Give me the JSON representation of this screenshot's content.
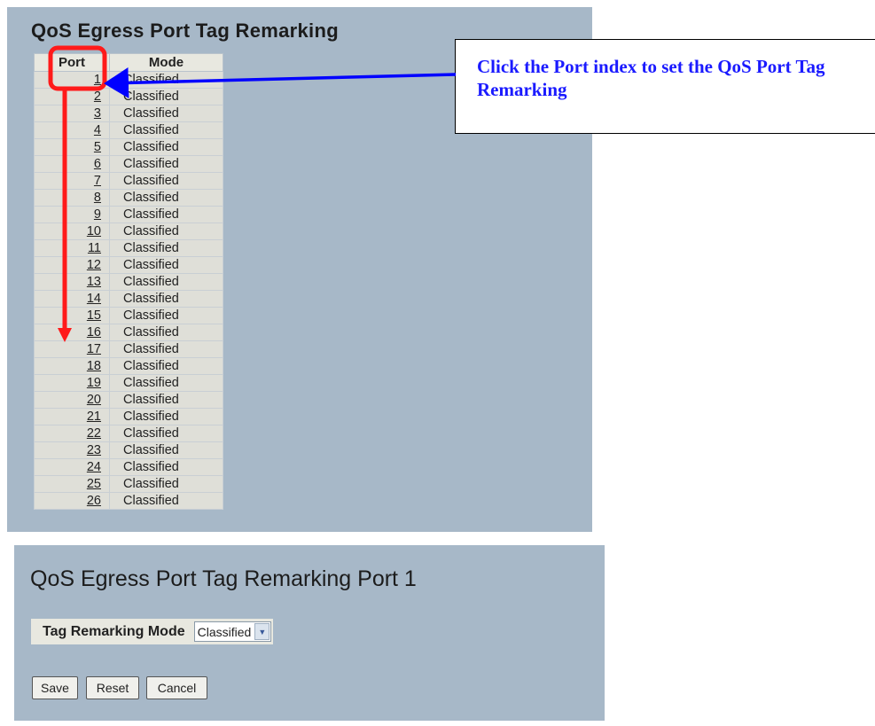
{
  "top": {
    "title": "QoS Egress Port Tag Remarking",
    "headers": {
      "port": "Port",
      "mode": "Mode"
    },
    "rows": [
      {
        "port": "1",
        "mode": "Classified"
      },
      {
        "port": "2",
        "mode": "Classified"
      },
      {
        "port": "3",
        "mode": "Classified"
      },
      {
        "port": "4",
        "mode": "Classified"
      },
      {
        "port": "5",
        "mode": "Classified"
      },
      {
        "port": "6",
        "mode": "Classified"
      },
      {
        "port": "7",
        "mode": "Classified"
      },
      {
        "port": "8",
        "mode": "Classified"
      },
      {
        "port": "9",
        "mode": "Classified"
      },
      {
        "port": "10",
        "mode": "Classified"
      },
      {
        "port": "11",
        "mode": "Classified"
      },
      {
        "port": "12",
        "mode": "Classified"
      },
      {
        "port": "13",
        "mode": "Classified"
      },
      {
        "port": "14",
        "mode": "Classified"
      },
      {
        "port": "15",
        "mode": "Classified"
      },
      {
        "port": "16",
        "mode": "Classified"
      },
      {
        "port": "17",
        "mode": "Classified"
      },
      {
        "port": "18",
        "mode": "Classified"
      },
      {
        "port": "19",
        "mode": "Classified"
      },
      {
        "port": "20",
        "mode": "Classified"
      },
      {
        "port": "21",
        "mode": "Classified"
      },
      {
        "port": "22",
        "mode": "Classified"
      },
      {
        "port": "23",
        "mode": "Classified"
      },
      {
        "port": "24",
        "mode": "Classified"
      },
      {
        "port": "25",
        "mode": "Classified"
      },
      {
        "port": "26",
        "mode": "Classified"
      }
    ]
  },
  "callout": {
    "text": "Click the Port index to set the QoS Port Tag Remarking"
  },
  "bottom": {
    "title": "QoS Egress Port Tag Remarking  Port 1",
    "mode_label": "Tag Remarking Mode",
    "mode_value": "Classified",
    "buttons": {
      "save": "Save",
      "reset": "Reset",
      "cancel": "Cancel"
    }
  },
  "colors": {
    "panel_bg": "#a7b8c8",
    "annotation_red": "#ff1a1a",
    "annotation_blue": "#0000ff",
    "callout_text": "#1a1aff"
  },
  "icons": {
    "select_arrow": "chevron-down-icon"
  }
}
